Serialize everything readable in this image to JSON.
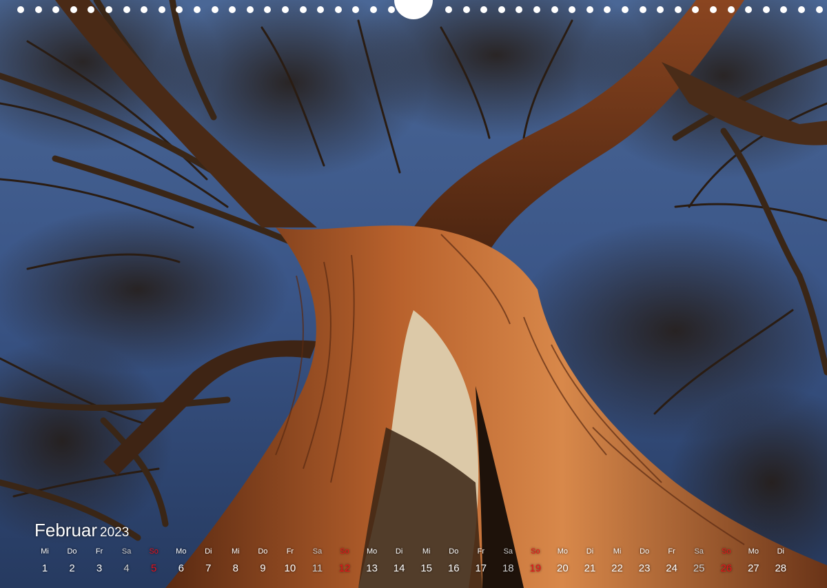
{
  "calendar": {
    "month": "Februar",
    "year": "2023",
    "days": [
      {
        "wd": "Mi",
        "d": "1"
      },
      {
        "wd": "Do",
        "d": "2"
      },
      {
        "wd": "Fr",
        "d": "3"
      },
      {
        "wd": "Sa",
        "d": "4"
      },
      {
        "wd": "So",
        "d": "5"
      },
      {
        "wd": "Mo",
        "d": "6"
      },
      {
        "wd": "Di",
        "d": "7"
      },
      {
        "wd": "Mi",
        "d": "8"
      },
      {
        "wd": "Do",
        "d": "9"
      },
      {
        "wd": "Fr",
        "d": "10"
      },
      {
        "wd": "Sa",
        "d": "11"
      },
      {
        "wd": "So",
        "d": "12"
      },
      {
        "wd": "Mo",
        "d": "13"
      },
      {
        "wd": "Di",
        "d": "14"
      },
      {
        "wd": "Mi",
        "d": "15"
      },
      {
        "wd": "Do",
        "d": "16"
      },
      {
        "wd": "Fr",
        "d": "17"
      },
      {
        "wd": "Sa",
        "d": "18"
      },
      {
        "wd": "So",
        "d": "19"
      },
      {
        "wd": "Mo",
        "d": "20"
      },
      {
        "wd": "Di",
        "d": "21"
      },
      {
        "wd": "Mi",
        "d": "22"
      },
      {
        "wd": "Do",
        "d": "23"
      },
      {
        "wd": "Fr",
        "d": "24"
      },
      {
        "wd": "Sa",
        "d": "25"
      },
      {
        "wd": "So",
        "d": "26"
      },
      {
        "wd": "Mo",
        "d": "27"
      },
      {
        "wd": "Di",
        "d": "28"
      }
    ]
  },
  "colors": {
    "sunday": "#e8101a",
    "saturday": "#d0d0d0",
    "text": "#ffffff",
    "sky": "#3d5a8a",
    "bark": "#b5652f"
  },
  "photo": {
    "subject_icon": "tree-photo"
  }
}
